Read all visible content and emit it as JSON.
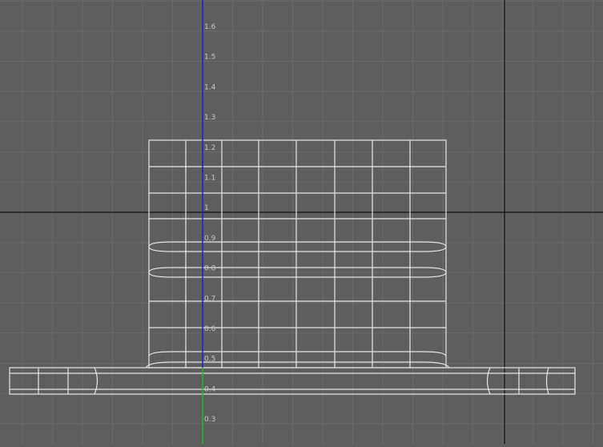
{
  "viewport": {
    "view": "ortho-front-wireframe",
    "background_color": "#5e5e5e",
    "grid_color": "#6b6b6b",
    "axis_y_color": "#1a1ad0",
    "axis_y_negative_color": "#20c020",
    "crosshair_color": "#111111",
    "wire_color": "#e6e6e6",
    "label_color": "#c8c8c8"
  },
  "ruler": {
    "labels": [
      "1.6",
      "1.5",
      "1.4",
      "1.3",
      "1.2",
      "1.1",
      "1",
      "0.9",
      "0.8",
      "0.7",
      "0.6",
      "0.5",
      "0.4",
      "0.3"
    ]
  }
}
